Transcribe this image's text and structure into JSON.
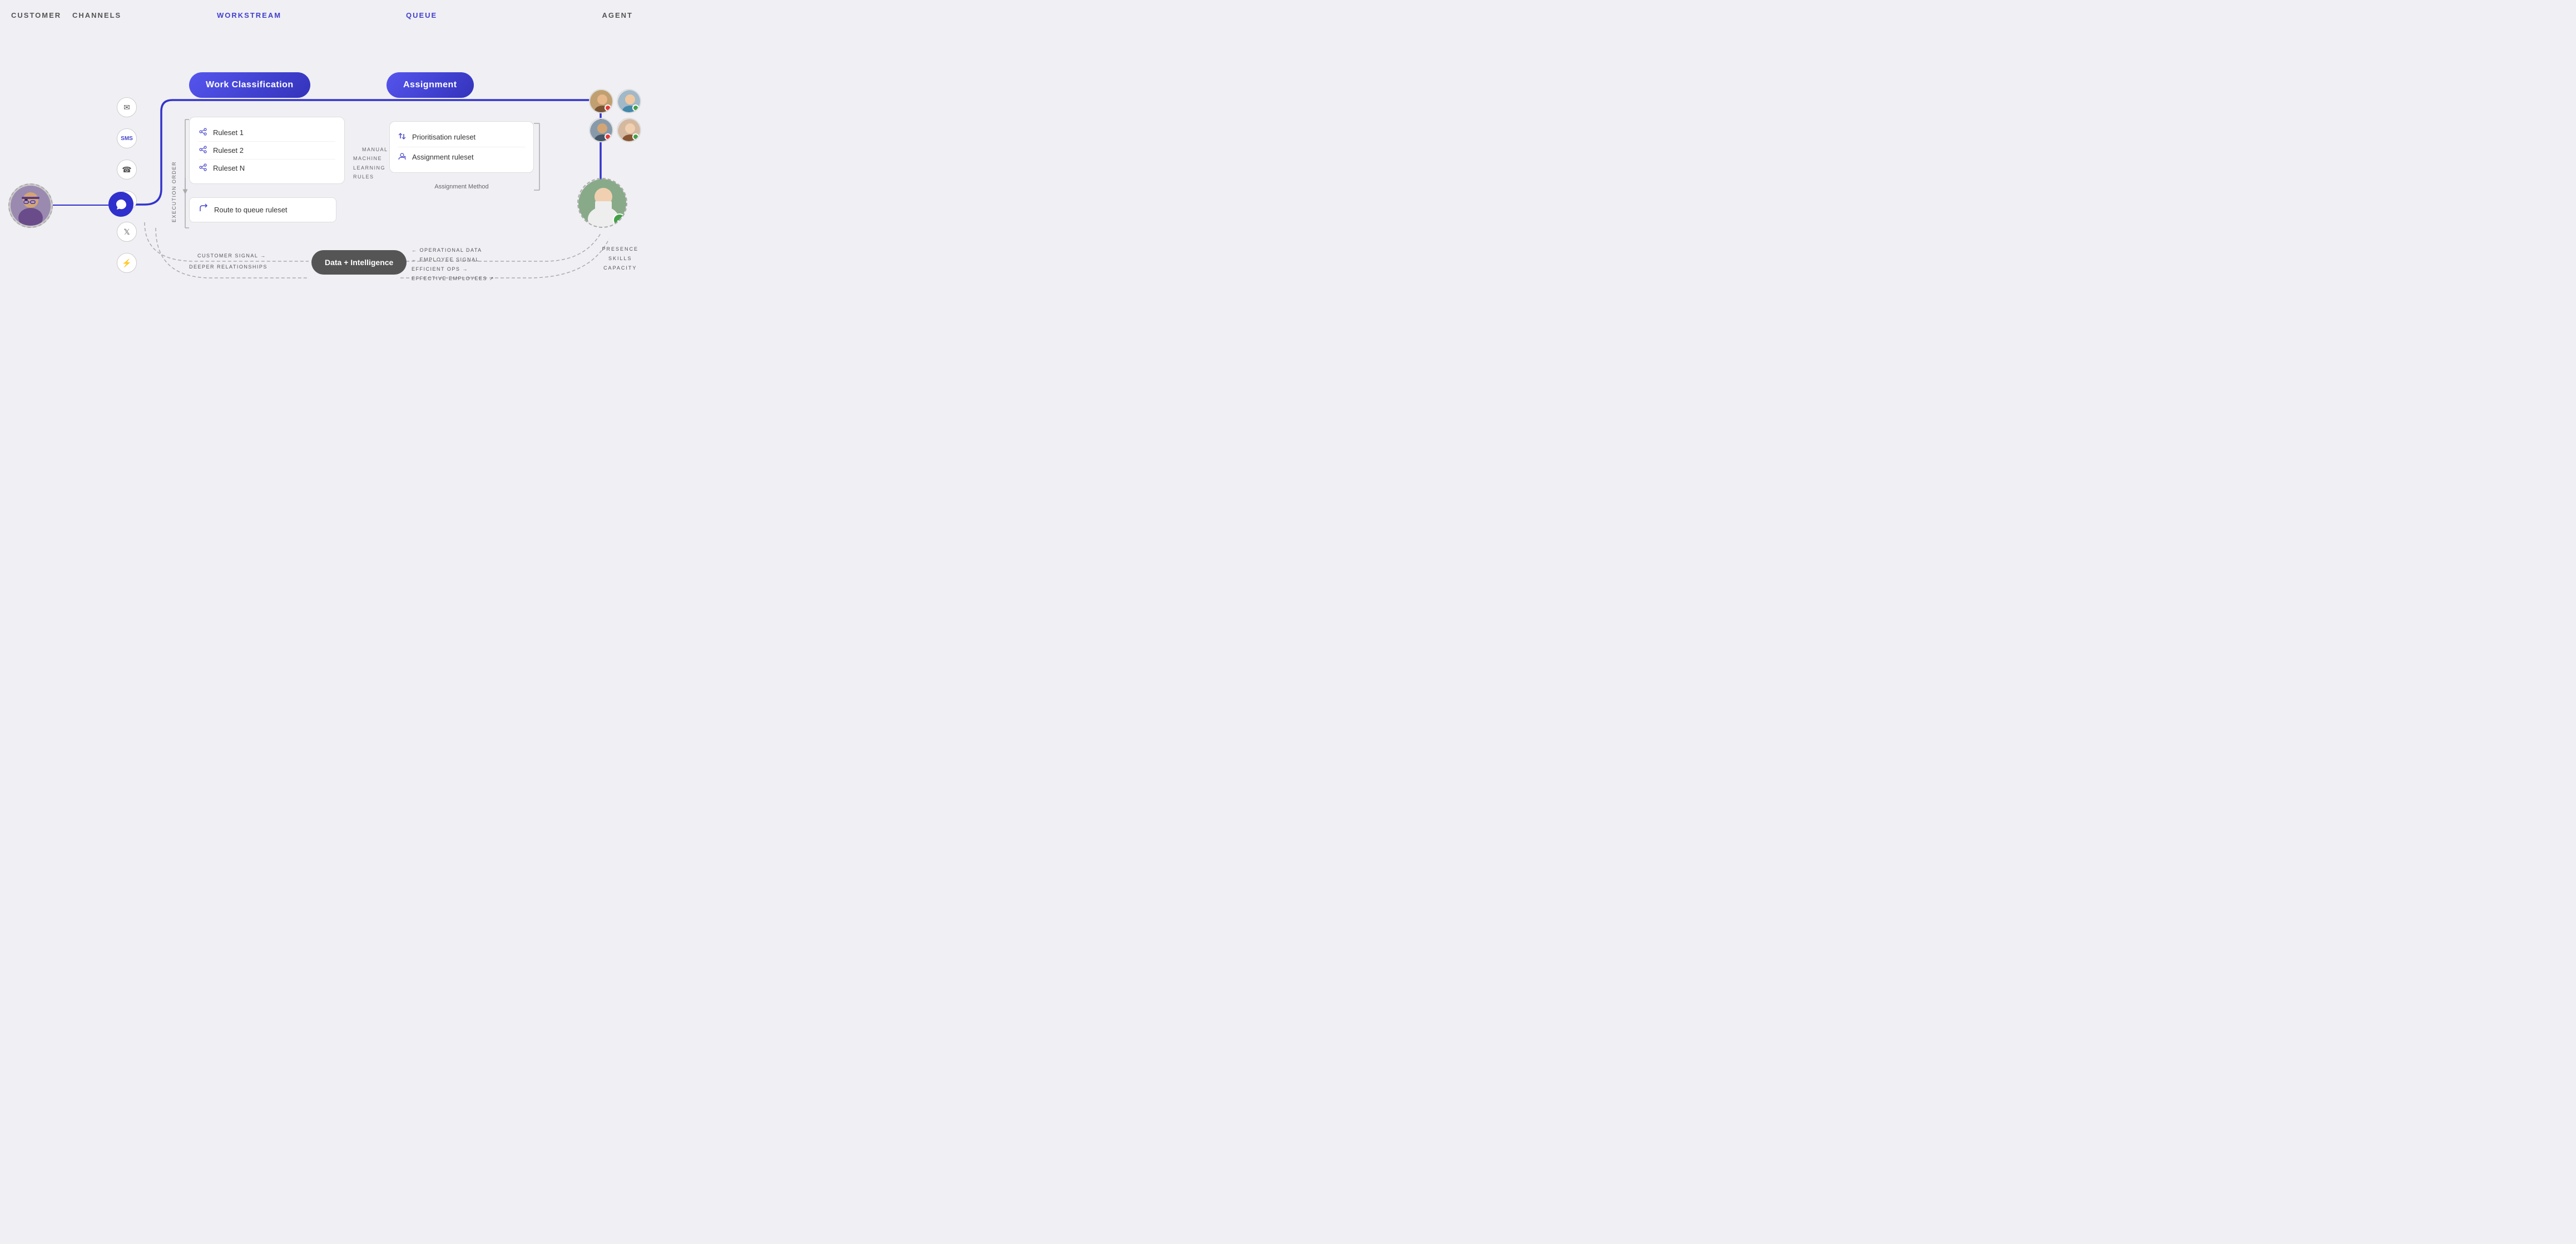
{
  "header": {
    "customer": "CUSTOMER",
    "channels": "CHANNELS",
    "workstream": "WORKSTREAM",
    "queue": "QUEUE",
    "agent": "AGENT"
  },
  "workClassification": {
    "label": "Work Classification"
  },
  "assignment": {
    "label": "Assignment"
  },
  "rulesets": [
    {
      "label": "Ruleset 1"
    },
    {
      "label": "Ruleset 2"
    },
    {
      "label": "Ruleset N"
    }
  ],
  "executionOrder": "Execution order",
  "mlRules": "MANUAL +\nMACHINE\nLEARNING\nRULES",
  "routeToQueue": "Route to queue ruleset",
  "prioritisation": "Prioritisation ruleset",
  "assignmentRuleset": "Assignment ruleset",
  "assignmentMethod": "Assignment Method",
  "dataIntelligence": "Data + Intelligence",
  "dataLabels": {
    "customerSignal": "CUSTOMER SIGNAL →",
    "deeperRelationships": "DEEPER RELATIONSHIPS",
    "operationalData": "← OPERATIONAL DATA",
    "employeeSignal": "← EMPLOYEE SIGNAL",
    "efficientOps": "EFFICIENT OPS →",
    "effectiveEmployees": "EFFECTIVE EMPLOYEES ↗"
  },
  "agentLabels": "PRESENCE\nSKILLS\nCAPACITY",
  "channels": [
    "✉",
    "💬",
    "☎",
    "⬡",
    "🐦",
    "💬"
  ],
  "colors": {
    "primary": "#3333cc",
    "primaryGrad": "#5555ee",
    "bg": "#f0eff4"
  }
}
